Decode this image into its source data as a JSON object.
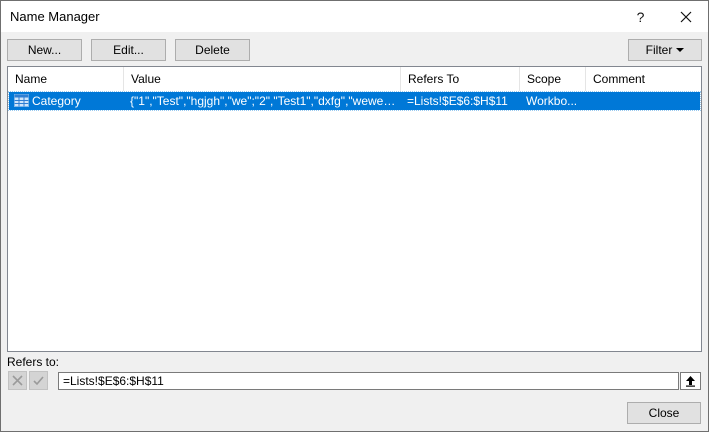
{
  "window": {
    "title": "Name Manager",
    "help": "?",
    "close": "✕"
  },
  "toolbar": {
    "new_label": "New...",
    "edit_label": "Edit...",
    "delete_label": "Delete",
    "filter_label": "Filter"
  },
  "table": {
    "columns": [
      "Name",
      "Value",
      "Refers To",
      "Scope",
      "Comment"
    ],
    "rows": [
      {
        "name": "Category",
        "value": "{\"1\",\"Test\",\"hgjgh\",\"we\";\"2\",\"Test1\",\"dxfg\",\"wewe\";\"...",
        "refers_to": "=Lists!$E$6:$H$11",
        "scope": "Workbo...",
        "comment": "",
        "icon": "table-grid-icon",
        "selected": true
      }
    ]
  },
  "refers_to": {
    "label": "Refers to:",
    "value": "=Lists!$E$6:$H$11"
  },
  "footer": {
    "close_label": "Close"
  },
  "colors": {
    "selection": "#0078d7",
    "button_face": "#e1e1e1",
    "dialog_bg": "#f0f0f0"
  }
}
